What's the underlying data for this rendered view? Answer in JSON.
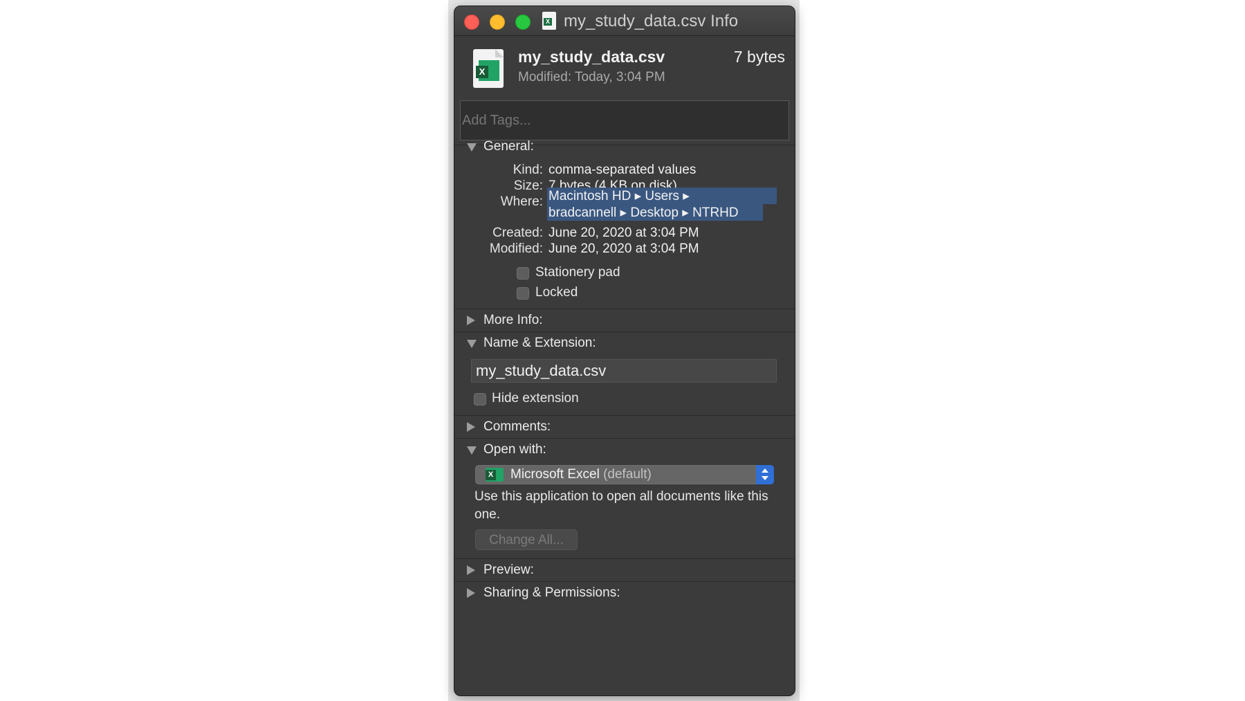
{
  "window": {
    "title": "my_study_data.csv Info"
  },
  "header": {
    "file_name": "my_study_data.csv",
    "file_size": "7 bytes",
    "modified_label": "Modified:",
    "modified_value": "Today, 3:04 PM"
  },
  "tags": {
    "placeholder": "Add Tags..."
  },
  "general": {
    "label": "General:",
    "kind_key": "Kind:",
    "kind_value": "comma-separated values",
    "size_key": "Size:",
    "size_value": "7 bytes (4 KB on disk)",
    "where_key": "Where:",
    "where_line1": "Macintosh HD ▸ Users ▸",
    "where_line2": "bradcannell ▸ Desktop ▸ NTRHD",
    "created_key": "Created:",
    "created_value": "June 20, 2020 at 3:04 PM",
    "modified_key": "Modified:",
    "modified_value": "June 20, 2020 at 3:04 PM",
    "stationery_label": "Stationery pad",
    "locked_label": "Locked"
  },
  "more_info": {
    "label": "More Info:"
  },
  "name_extension": {
    "label": "Name & Extension:",
    "name_value": "my_study_data.csv",
    "hide_extension_label": "Hide extension"
  },
  "comments": {
    "label": "Comments:"
  },
  "open_with": {
    "label": "Open with:",
    "app_name": "Microsoft Excel",
    "app_default": "(default)",
    "help_text": "Use this application to open all documents like this one.",
    "change_all_label": "Change All..."
  },
  "preview": {
    "label": "Preview:"
  },
  "sharing": {
    "label": "Sharing & Permissions:"
  }
}
